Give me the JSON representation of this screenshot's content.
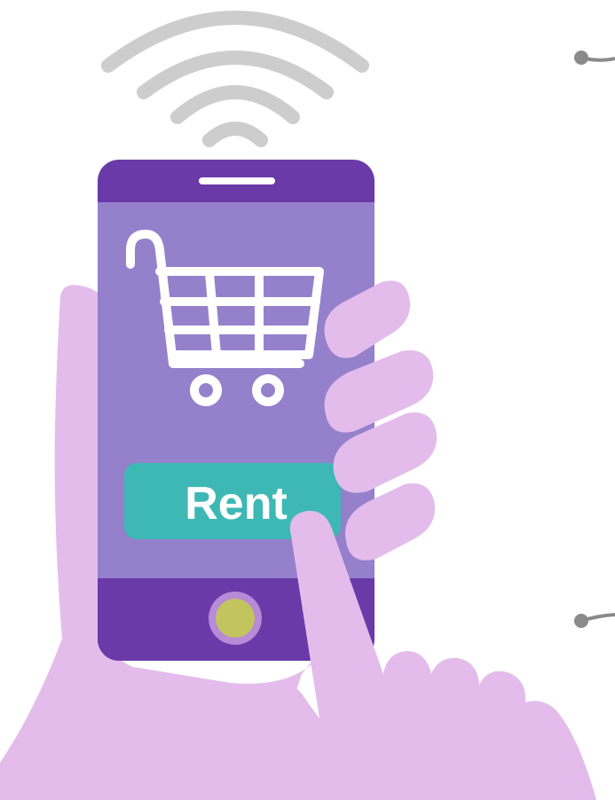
{
  "rent_button": {
    "label": "Rent"
  },
  "colors": {
    "phone_body": "#6a3aa8",
    "screen": "#9580cc",
    "rent_button": "#3db8b5",
    "home_button_ring": "#b88ad8",
    "home_button_center": "#c2c45e",
    "hand": "#e3bceb",
    "wifi": "#cdcdcd",
    "cart": "#ffffff",
    "connector": "#8a8a8a"
  },
  "icons": [
    "wifi-signal-icon",
    "shopping-cart-icon"
  ]
}
